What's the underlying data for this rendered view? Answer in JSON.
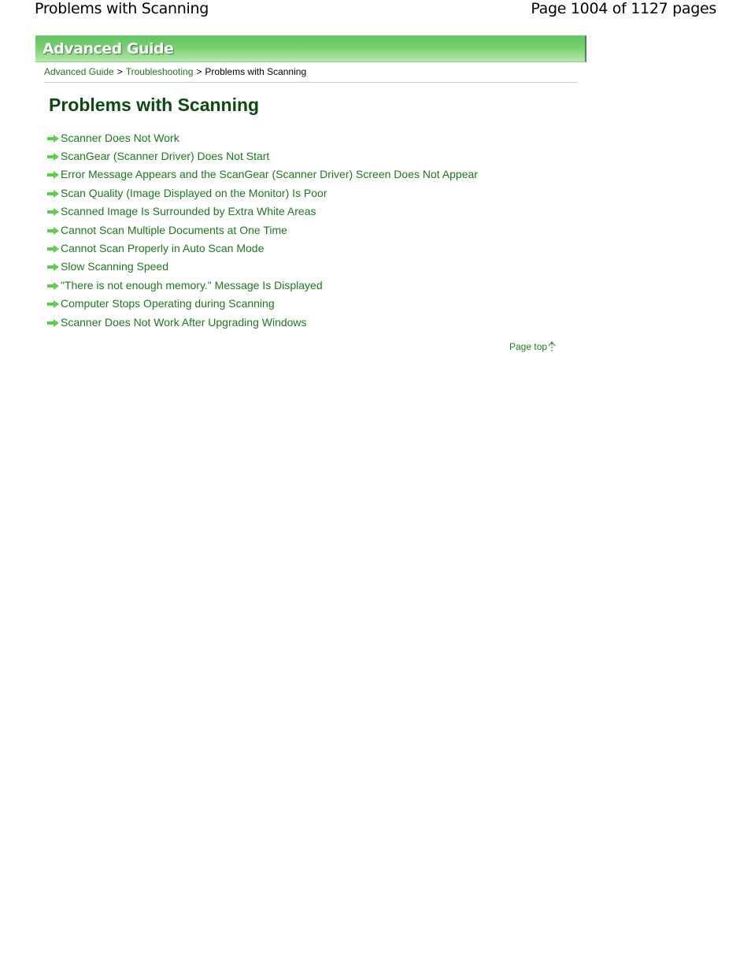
{
  "pdf_header": {
    "title": "Problems with Scanning",
    "page_info": "Page 1004 of 1127 pages"
  },
  "banner": {
    "title": "Advanced Guide"
  },
  "breadcrumb": {
    "items": [
      {
        "label": "Advanced Guide",
        "link": true
      },
      {
        "label": "Troubleshooting",
        "link": true
      },
      {
        "label": "Problems with Scanning",
        "link": false
      }
    ],
    "separator": ">"
  },
  "page_title": "Problems with Scanning",
  "topics": [
    {
      "label": "Scanner Does Not Work",
      "icon": "arrow-right-icon"
    },
    {
      "label": "ScanGear (Scanner Driver) Does Not Start",
      "icon": "arrow-right-icon"
    },
    {
      "label": "Error Message Appears and the ScanGear (Scanner Driver) Screen Does Not Appear",
      "icon": "arrow-right-icon"
    },
    {
      "label": "Scan Quality (Image Displayed on the Monitor) Is Poor",
      "icon": "arrow-right-icon"
    },
    {
      "label": "Scanned Image Is Surrounded by Extra White Areas",
      "icon": "arrow-right-icon"
    },
    {
      "label": "Cannot Scan Multiple Documents at One Time",
      "icon": "arrow-right-icon"
    },
    {
      "label": "Cannot Scan Properly in Auto Scan Mode",
      "icon": "arrow-right-icon"
    },
    {
      "label": "Slow Scanning Speed",
      "icon": "arrow-right-icon"
    },
    {
      "label": "\"There is not enough memory.\" Message Is Displayed",
      "icon": "arrow-right-icon"
    },
    {
      "label": "Computer Stops Operating during Scanning",
      "icon": "arrow-right-icon"
    },
    {
      "label": "Scanner Does Not Work After Upgrading Windows",
      "icon": "arrow-right-icon"
    }
  ],
  "page_top": {
    "label": "Page top",
    "icon": "arrow-up-icon"
  },
  "colors": {
    "link": "#1b7a1b",
    "title": "#0b4a10",
    "banner": "#76cf6e",
    "arrow": "#5ccf4f"
  }
}
